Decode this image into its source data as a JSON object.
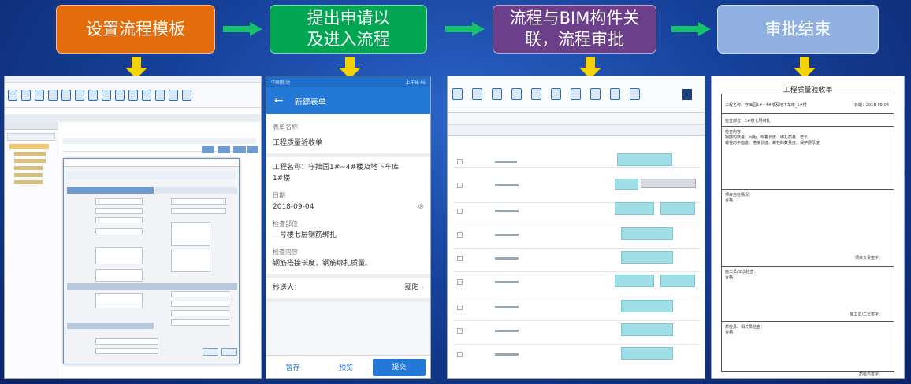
{
  "stages": [
    {
      "label": "设置流程模板",
      "color": "#e46c0a"
    },
    {
      "label": "提出申请以及进入流程",
      "line1": "提出申请以",
      "line2": "及进入流程",
      "color": "#00a651"
    },
    {
      "label": "流程与BIM构件关联，流程审批",
      "line1": "流程与BIM构件关",
      "line2": "联，流程审批",
      "color": "#6c3f8b"
    },
    {
      "label": "审批结束",
      "color": "#8fb0e0"
    }
  ],
  "arrow_color": "#13c26b",
  "down_arrow_color": "#f5d300",
  "mobile_form": {
    "status_left": "中国移动",
    "status_right": "上午8:46",
    "header_title": "新建表单",
    "form_name_label": "表单名称",
    "form_name_value": "工程质量验收单",
    "project_name": "工程名称：守拙园1#~4#楼及地下车库",
    "building": "1#楼",
    "date_label": "日期",
    "date_value": "2018-09-04",
    "inspect_part_label": "检查部位",
    "inspect_part_value": "一号楼七层钢筋绑扎",
    "inspect_content_label": "检查内容",
    "inspect_content_value": "钢筋搭接长度，钢筋绑扎质量。",
    "cc_label": "抄送人：",
    "cc_value": "鄢阳",
    "btn_save": "暂存",
    "btn_preview": "预览",
    "btn_submit": "提交"
  },
  "document": {
    "title": "工程质量验收单",
    "project": "工程名称：守拙园1#~4#楼及地下车库_1#楼",
    "date": "日期：2018-09-04",
    "part": "检查部位：1#楼七层绑扎",
    "content_title": "检查内容：",
    "content_body": "钢筋的数量、间距、规格长度、绑扎质量、套长",
    "content_body2": "螺栓的平面度、搭接长度、螺栓的数量度、保护层厚度",
    "opinion1": "项目自检情况：",
    "ok1": "合格",
    "sign1": "项目负责签字：",
    "opinion2": "施工员/工长检查：",
    "ok2": "合格",
    "sign2": "施工员/工长签字：",
    "opinion3": "质检员、相关员检查：",
    "ok3": "合格",
    "sign3": "质检员签字："
  }
}
